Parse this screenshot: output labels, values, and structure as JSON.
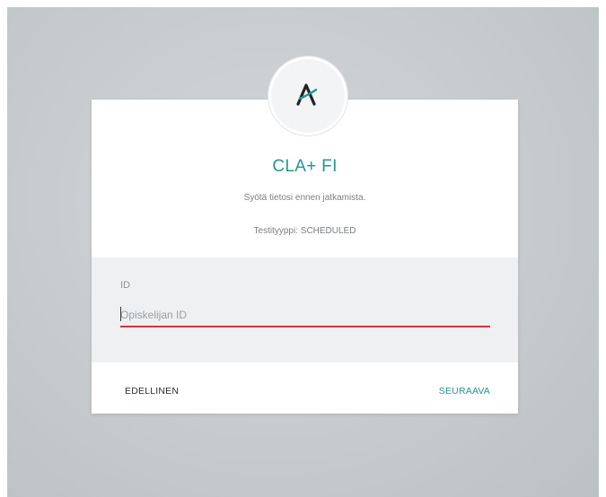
{
  "app": {
    "logo_icon": "cla-logo-icon",
    "brand_color": "#21968f",
    "title": "CLA+ FI",
    "subtitle": "Syötä tietosi ennen jatkamista.",
    "test_type": "Testityyppi: SCHEDULED"
  },
  "form": {
    "id_label": "ID",
    "id_value": "",
    "id_placeholder": "Opiskelijan ID",
    "error_color": "#d8323c"
  },
  "actions": {
    "previous_label": "EDELLINEN",
    "next_label": "SEURAAVA"
  }
}
